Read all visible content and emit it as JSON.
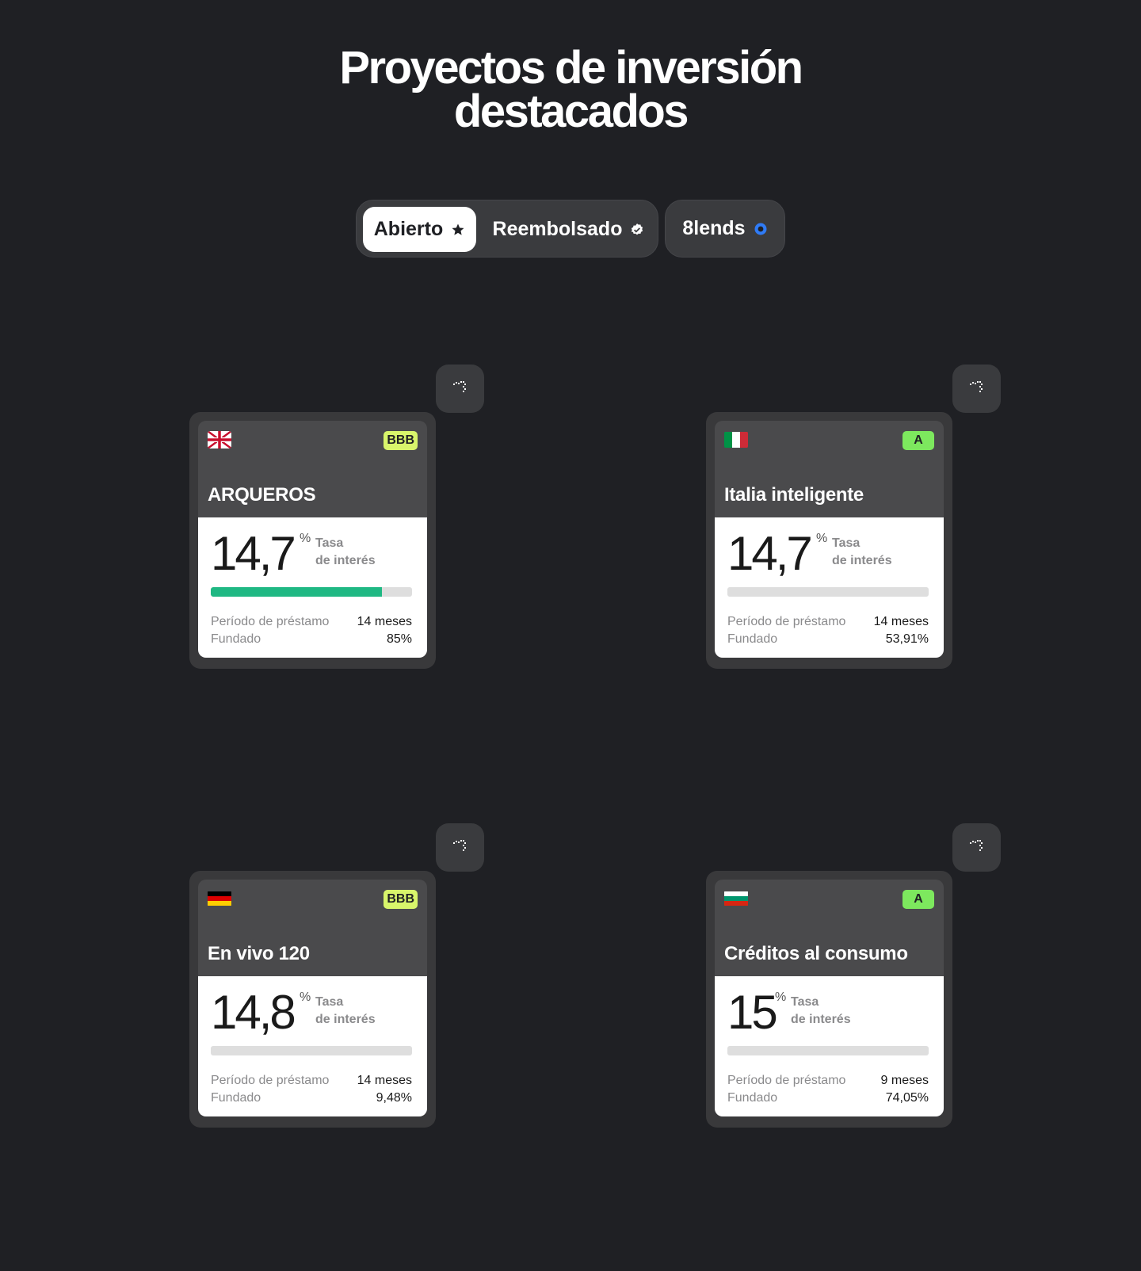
{
  "header": {
    "title_line1": "Proyectos de inversión",
    "title_line2": "destacados"
  },
  "tabs": {
    "open_label": "Abierto",
    "repaid_label": "Reembolsado",
    "brand_label": "8lends"
  },
  "labels": {
    "rate_label_line1": "Tasa",
    "rate_label_line2": "de interés",
    "period_key": "Período de préstamo",
    "funded_key": "Fundado",
    "percent_sign": "%"
  },
  "colors": {
    "bbb_badge": "#d8f56b",
    "a_badge": "#7de85e",
    "progress_fill": "#1fb883",
    "accent_blue": "#2f7bf6"
  },
  "projects": [
    {
      "name": "ARQUEROS",
      "flag": "uk-flag-icon",
      "rating": "BBB",
      "rate": "14,7",
      "period": "14 meses",
      "funded": "85%",
      "funded_fraction": 0.85
    },
    {
      "name": "Italia inteligente",
      "flag": "italy-flag-icon",
      "rating": "A",
      "rate": "14,7",
      "period": "14 meses",
      "funded": "53,91%",
      "funded_fraction": 0
    },
    {
      "name": "En vivo 120",
      "flag": "germany-flag-icon",
      "rating": "BBB",
      "rate": "14,8",
      "period": "14 meses",
      "funded": "9,48%",
      "funded_fraction": 0
    },
    {
      "name": "Créditos al consumo",
      "flag": "bulgaria-flag-icon",
      "rating": "A",
      "rate": "15",
      "period": "9 meses",
      "funded": "74,05%",
      "funded_fraction": 0
    }
  ]
}
